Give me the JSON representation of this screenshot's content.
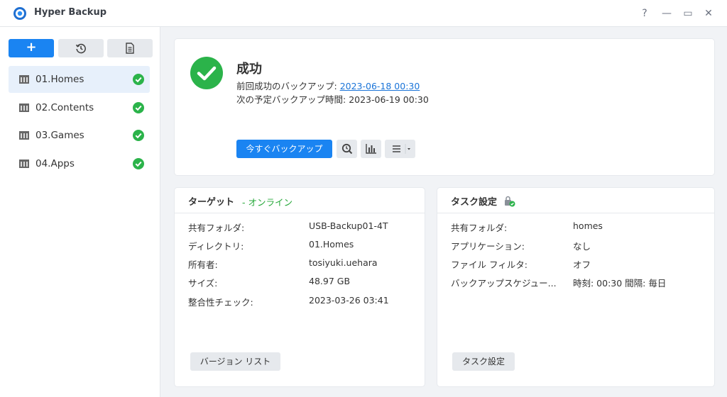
{
  "app": {
    "title": "Hyper Backup"
  },
  "window": {
    "help": "?",
    "minimize": "—",
    "maximize": "▭",
    "close": "✕"
  },
  "colors": {
    "accent": "#1a84f2",
    "success": "#2bb34a",
    "online": "#26a83a",
    "link": "#1a74d8"
  },
  "sidebar": {
    "toolbar": {
      "add": "+",
      "history_icon": "history-icon",
      "log_icon": "document-icon"
    },
    "tasks": [
      {
        "label": "01.Homes",
        "status": "success"
      },
      {
        "label": "02.Contents",
        "status": "success"
      },
      {
        "label": "03.Games",
        "status": "success"
      },
      {
        "label": "04.Apps",
        "status": "success"
      }
    ]
  },
  "status": {
    "title": "成功",
    "last_label": "前回成功のバックアップ: ",
    "last_value": "2023-06-18 00:30",
    "next_label": "次の予定バックアップ時間: ",
    "next_value": "2023-06-19 00:30",
    "backup_now": "今すぐバックアップ"
  },
  "target": {
    "title": "ターゲット",
    "online": "- オンライン",
    "rows": [
      {
        "key": "共有フォルダ:",
        "value": "USB-Backup01-4T"
      },
      {
        "key": "ディレクトリ:",
        "value": "01.Homes"
      },
      {
        "key": "所有者:",
        "value": "tosiyuki.uehara"
      },
      {
        "key": "サイズ:",
        "value": "48.97 GB"
      },
      {
        "key": "整合性チェック:",
        "value": "2023-03-26 03:41"
      }
    ],
    "button": "バージョン リスト"
  },
  "task": {
    "title": "タスク設定",
    "rows": [
      {
        "key": "共有フォルダ:",
        "value": "homes"
      },
      {
        "key": "アプリケーション:",
        "value": "なし"
      },
      {
        "key": "ファイル フィルタ:",
        "value": "オフ"
      },
      {
        "key": "バックアップスケジュー...",
        "value": "時刻: 00:30 間隔: 毎日"
      }
    ],
    "button": "タスク設定"
  }
}
